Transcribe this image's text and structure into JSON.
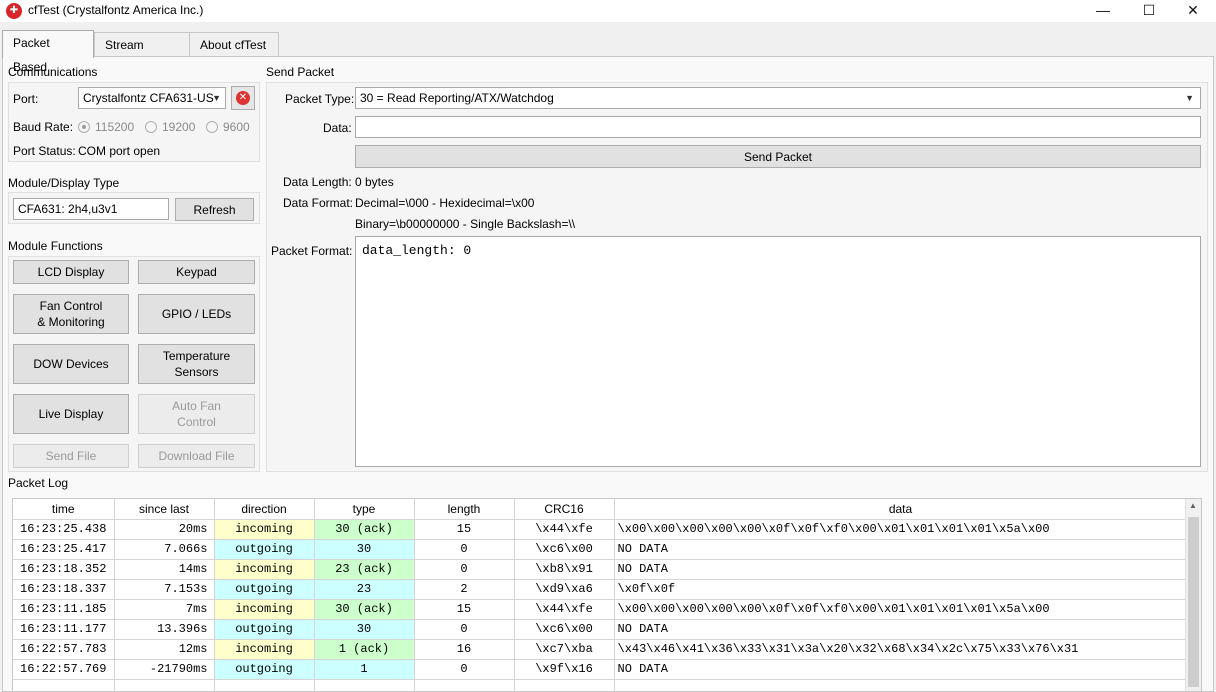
{
  "window": {
    "title": "cfTest (Crystalfontz America Inc.)",
    "app_icon_glyph": "✚",
    "minimize": "—",
    "maximize": "☐",
    "close": "✕"
  },
  "tabs": [
    {
      "label": "Packet Based",
      "active": true
    },
    {
      "label": "Stream Based",
      "active": false
    },
    {
      "label": "About cfTest",
      "active": false
    }
  ],
  "communications": {
    "group_label": "Communications",
    "port_label": "Port:",
    "port_value": "Crystalfontz CFA631-US",
    "baud_label": "Baud Rate:",
    "baud_options": [
      "115200",
      "19200",
      "9600"
    ],
    "baud_selected": "115200",
    "port_status_label": "Port Status:",
    "port_status_value": "COM port open"
  },
  "module_display": {
    "group_label": "Module/Display Type",
    "value": "CFA631: 2h4,u3v1",
    "refresh_label": "Refresh"
  },
  "module_functions": {
    "group_label": "Module Functions",
    "lcd_display": "LCD Display",
    "keypad": "Keypad",
    "fan_control_line1": "Fan Control",
    "fan_control_line2": "& Monitoring",
    "gpio_leds": "GPIO / LEDs",
    "dow_devices": "DOW Devices",
    "temp_line1": "Temperature",
    "temp_line2": "Sensors",
    "live_display": "Live Display",
    "auto_fan_line1": "Auto Fan",
    "auto_fan_line2": "Control",
    "send_file": "Send File",
    "download_file": "Download File"
  },
  "send_packet": {
    "group_label": "Send Packet",
    "packet_type_label": "Packet Type:",
    "packet_type_value": "30 = Read Reporting/ATX/Watchdog",
    "data_label": "Data:",
    "data_value": "",
    "send_button": "Send Packet",
    "data_length_label": "Data Length:",
    "data_length_value": "0 bytes",
    "data_format_label": "Data Format:",
    "data_format_line1": "Decimal=\\000 - Hexidecimal=\\x00",
    "data_format_line2": "Binary=\\b00000000 - Single Backslash=\\\\",
    "packet_format_label": "Packet Format:",
    "packet_format_value": "data_length: 0"
  },
  "packet_log": {
    "group_label": "Packet Log",
    "columns": [
      "time",
      "since last",
      "direction",
      "type",
      "length",
      "CRC16",
      "data"
    ],
    "rows": [
      {
        "time": "16:23:25.438",
        "since": "20ms",
        "direction": "incoming",
        "type": "30 (ack)",
        "length": "15",
        "crc": "\\x44\\xfe",
        "data": "\\x00\\x00\\x00\\x00\\x00\\x0f\\x0f\\xf0\\x00\\x01\\x01\\x01\\x01\\x5a\\x00"
      },
      {
        "time": "16:23:25.417",
        "since": "7.066s",
        "direction": "outgoing",
        "type": "30",
        "length": "0",
        "crc": "\\xc6\\x00",
        "data": "NO DATA"
      },
      {
        "time": "16:23:18.352",
        "since": "14ms",
        "direction": "incoming",
        "type": "23 (ack)",
        "length": "0",
        "crc": "\\xb8\\x91",
        "data": "NO DATA"
      },
      {
        "time": "16:23:18.337",
        "since": "7.153s",
        "direction": "outgoing",
        "type": "23",
        "length": "2",
        "crc": "\\xd9\\xa6",
        "data": "\\x0f\\x0f"
      },
      {
        "time": "16:23:11.185",
        "since": "7ms",
        "direction": "incoming",
        "type": "30 (ack)",
        "length": "15",
        "crc": "\\x44\\xfe",
        "data": "\\x00\\x00\\x00\\x00\\x00\\x0f\\x0f\\xf0\\x00\\x01\\x01\\x01\\x01\\x5a\\x00"
      },
      {
        "time": "16:23:11.177",
        "since": "13.396s",
        "direction": "outgoing",
        "type": "30",
        "length": "0",
        "crc": "\\xc6\\x00",
        "data": "NO DATA"
      },
      {
        "time": "16:22:57.783",
        "since": "12ms",
        "direction": "incoming",
        "type": "1 (ack)",
        "length": "16",
        "crc": "\\xc7\\xba",
        "data": "\\x43\\x46\\x41\\x36\\x33\\x31\\x3a\\x20\\x32\\x68\\x34\\x2c\\x75\\x33\\x76\\x31"
      },
      {
        "time": "16:22:57.769",
        "since": "-21790ms",
        "direction": "outgoing",
        "type": "1",
        "length": "0",
        "crc": "\\x9f\\x16",
        "data": "NO DATA"
      }
    ]
  },
  "colors": {
    "incoming_bg": "#ffffcc",
    "outgoing_bg": "#ccffff",
    "ack_bg": "#ccffcc",
    "close_red": "#d33333"
  }
}
